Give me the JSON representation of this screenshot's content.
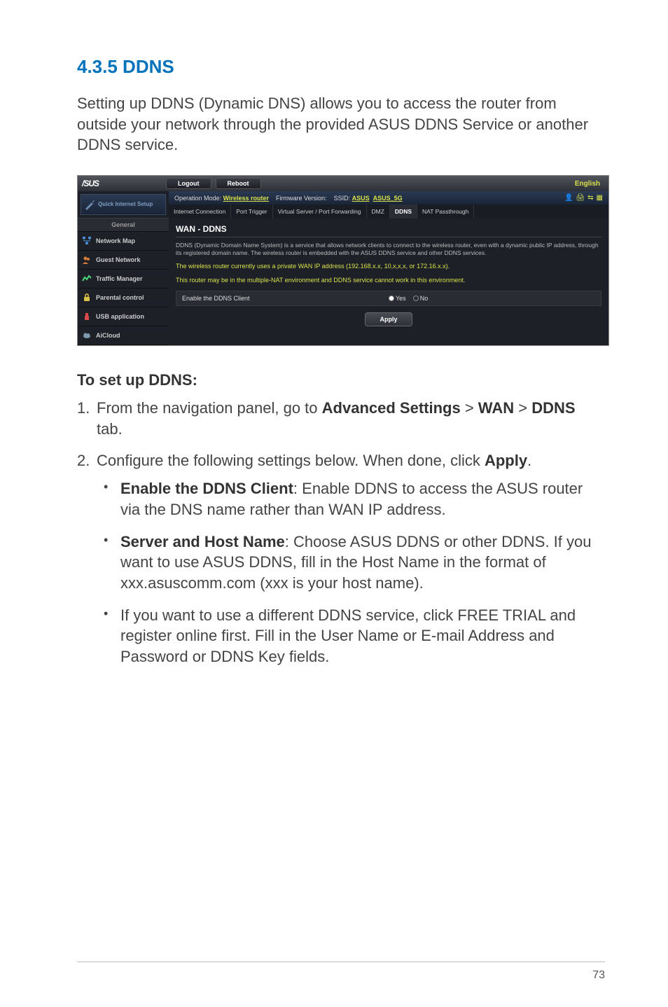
{
  "section_title": "4.3.5 DDNS",
  "intro": "Setting up DDNS (Dynamic DNS) allows you to access the router from outside your network through the provided ASUS DDNS Service or another DDNS service.",
  "screenshot": {
    "logo": "/SUS",
    "logout": "Logout",
    "reboot": "Reboot",
    "english": "English",
    "op_mode_label": "Operation Mode:",
    "op_mode_value": "Wireless router",
    "fw_label": "Firmware Version:",
    "ssid_label": "SSID:",
    "ssid1": "ASUS",
    "ssid2": "ASUS_5G",
    "quick": "Quick Internet Setup",
    "side_general": "General",
    "side_items": [
      "Network Map",
      "Guest Network",
      "Traffic Manager",
      "Parental control",
      "USB application",
      "AiCloud"
    ],
    "tabs": [
      "Internet Connection",
      "Port Trigger",
      "Virtual Server / Port Forwarding",
      "DMZ",
      "DDNS",
      "NAT Passthrough"
    ],
    "active_tab_index": 4,
    "wan_title": "WAN - DDNS",
    "desc": "DDNS (Dynamic Domain Name System) is a service that allows network clients to connect to the wireless router, even with a dynamic public IP address, through its registered domain name. The wireless router is embedded with the ASUS DDNS service and other DDNS services.",
    "warn1": "The wireless router currently uses a private WAN IP address (192.168.x.x, 10,x,x,x, or 172.16.x.x).",
    "warn2": "This router may be in the multiple-NAT environment and DDNS service cannot work in this environment.",
    "enable_label": "Enable the DDNS Client",
    "yes": "Yes",
    "no": "No",
    "apply": "Apply"
  },
  "sub_heading": "To set up DDNS:",
  "step1_a": "From the navigation panel, go to ",
  "step1_b": "Advanced Settings",
  "step1_c": " > ",
  "step1_d": "WAN",
  "step1_e": " > ",
  "step1_f": "DDNS",
  "step1_g": " tab.",
  "step2_a": "Configure the following settings below. When done, click ",
  "step2_b": "Apply",
  "step2_c": ".",
  "bullet1_a": "Enable the DDNS Client",
  "bullet1_b": ": Enable DDNS to access the ASUS router via the DNS name rather than WAN IP address.",
  "bullet2_a": "Server and Host Name",
  "bullet2_b": ": Choose ASUS DDNS or other DDNS. If you want to use ASUS DDNS, fill in the Host Name in the format of xxx.asuscomm.com (xxx is your host name).",
  "bullet3": "If you want to use a different DDNS service, click FREE TRIAL and register online first. Fill in the User Name or E-mail Address and Password or DDNS Key fields.",
  "page_number": "73"
}
